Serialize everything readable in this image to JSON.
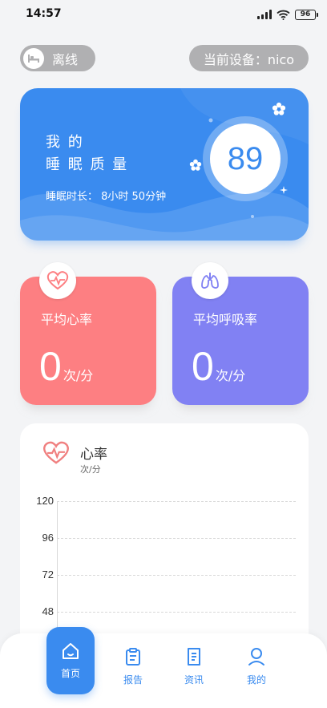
{
  "status_bar": {
    "time": "14:57",
    "battery": "96"
  },
  "header": {
    "status_label": "离线",
    "device_label": "当前设备：nico"
  },
  "sleep_card": {
    "title_line1": "我 的",
    "title_line2": "睡 眠 质 量",
    "duration": "睡眠时长：  8小时 50分钟",
    "score": "89"
  },
  "stats": {
    "heart": {
      "label": "平均心率",
      "value": "0",
      "unit": "次/分"
    },
    "respiration": {
      "label": "平均呼吸率",
      "value": "0",
      "unit": "次/分"
    }
  },
  "chart_data": {
    "type": "line",
    "title": "心率",
    "ylabel": "次/分",
    "yticks": [
      "120",
      "96",
      "72",
      "48"
    ],
    "ylim": [
      48,
      120
    ],
    "series": []
  },
  "colors": {
    "accent": "#3a8bef",
    "heart": "#fd7f82",
    "respiration": "#8181f3"
  },
  "nav": {
    "items": [
      {
        "label": "首页",
        "icon": "home-icon",
        "active": true
      },
      {
        "label": "报告",
        "icon": "report-icon",
        "active": false
      },
      {
        "label": "资讯",
        "icon": "news-icon",
        "active": false
      },
      {
        "label": "我的",
        "icon": "profile-icon",
        "active": false
      }
    ]
  }
}
